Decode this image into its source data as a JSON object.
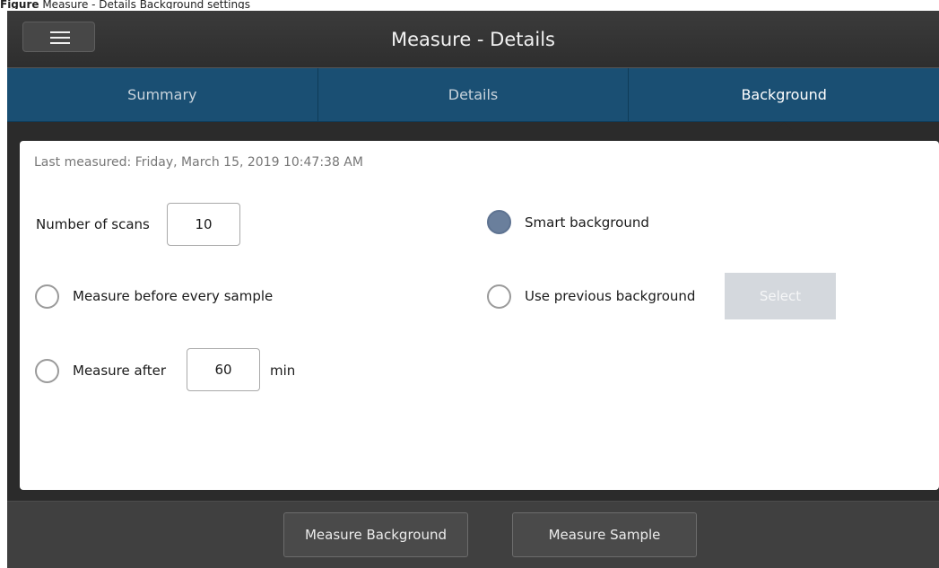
{
  "caption": {
    "prefix": "Figure",
    "text": "Measure - Details Background settings"
  },
  "app": {
    "title": "Measure - Details",
    "menu_icon": "hamburger-menu-icon"
  },
  "tabs": [
    {
      "label": "Summary",
      "active": false
    },
    {
      "label": "Details",
      "active": false
    },
    {
      "label": "Background",
      "active": true
    }
  ],
  "background": {
    "last_measured": "Last measured: Friday, March 15, 2019 10:47:38 AM",
    "scans_label": "Number of scans",
    "scans_value": "10",
    "measure_before_label": "Measure before every sample",
    "measure_before_selected": false,
    "measure_after_label": "Measure after",
    "measure_after_value": "60",
    "measure_after_unit": "min",
    "measure_after_selected": false,
    "smart_label": "Smart background",
    "smart_selected": true,
    "use_previous_label": "Use previous background",
    "use_previous_selected": false,
    "select_label": "Select"
  },
  "actions": {
    "measure_background": "Measure Background",
    "measure_sample": "Measure Sample"
  },
  "colors": {
    "tab_bar": "#1a4f73",
    "radio_selected": "#6a7f9c",
    "select_disabled": "#d4d8dd"
  }
}
